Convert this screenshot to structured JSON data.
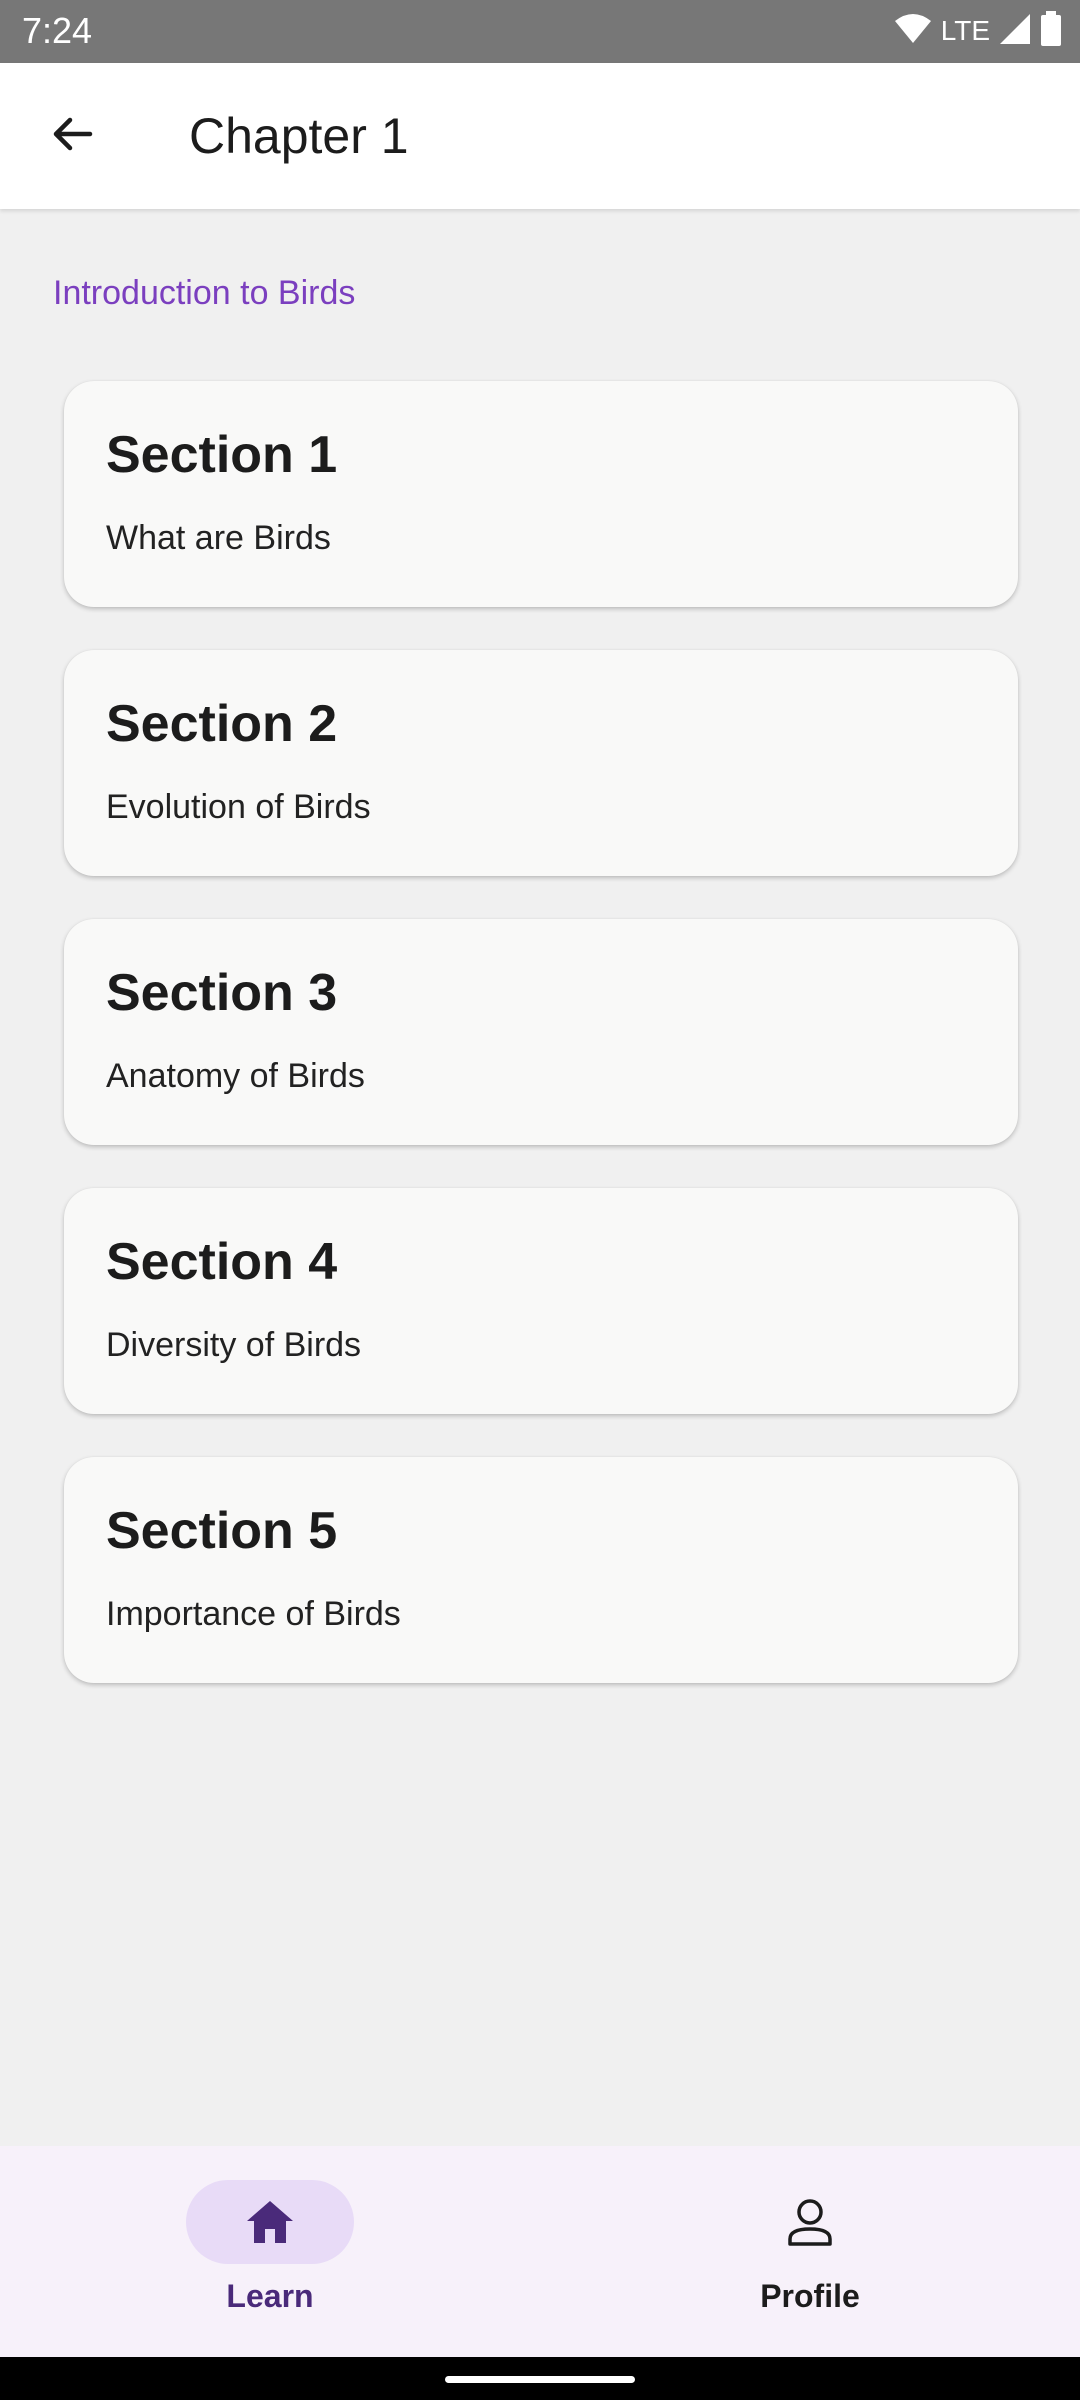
{
  "status_bar": {
    "time": "7:24",
    "network": "LTE",
    "icons": [
      "wifi-icon",
      "signal-icon",
      "battery-icon"
    ]
  },
  "app_bar": {
    "title": "Chapter 1",
    "back_icon": "arrow-back-icon"
  },
  "chapter": {
    "subtitle": "Introduction to Birds"
  },
  "sections": [
    {
      "title": "Section 1",
      "description": "What are Birds"
    },
    {
      "title": "Section 2",
      "description": "Evolution of Birds"
    },
    {
      "title": "Section 3",
      "description": "Anatomy of Birds"
    },
    {
      "title": "Section 4",
      "description": "Diversity of Birds"
    },
    {
      "title": "Section 5",
      "description": "Importance of Birds"
    }
  ],
  "bottom_nav": {
    "items": [
      {
        "label": "Learn",
        "icon": "home-icon",
        "selected": true
      },
      {
        "label": "Profile",
        "icon": "person-icon",
        "selected": false
      }
    ]
  },
  "colors": {
    "accent": "#7b3fbf",
    "nav_selected_bg": "#e8dbf7",
    "nav_bg": "#f7f1fa",
    "card_bg": "#f9f9f8",
    "page_bg": "#f0f0f0"
  }
}
